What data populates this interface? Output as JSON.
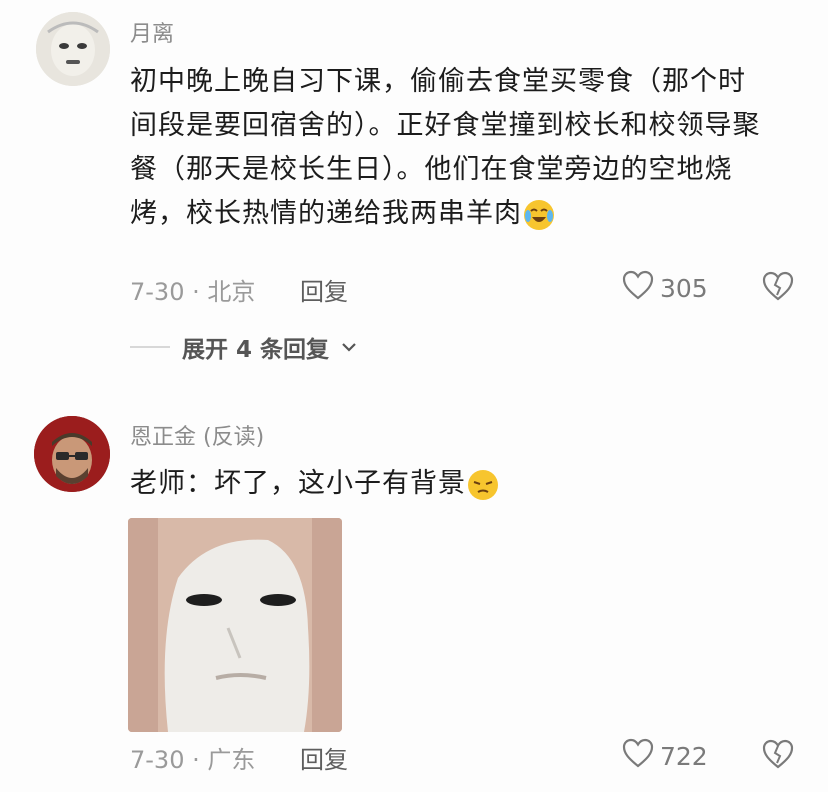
{
  "comments": [
    {
      "username": "月离",
      "text": "初中晚上晚自习下课，偷偷去食堂买零食（那个时间段是要回宿舍的）。正好食堂撞到校长和校领导聚餐（那天是校长生日）。他们在食堂旁边的空地烧烤，校长热情的递给我两串羊肉",
      "emoji": "crying-laughing-emoji",
      "date_location": "7-30 · 北京",
      "reply_label": "回复",
      "likes": "305",
      "expand_label": "展开 4 条回复"
    },
    {
      "username": "恩正金 (反读)",
      "text": "老师：坏了，这小子有背景",
      "emoji": "smirk-emoji",
      "date_location": "7-30 · 广东",
      "reply_label": "回复",
      "likes": "722"
    }
  ],
  "colors": {
    "background": "#fdfdfd",
    "username": "#8c8c8c",
    "meta": "#9a9a9a"
  }
}
